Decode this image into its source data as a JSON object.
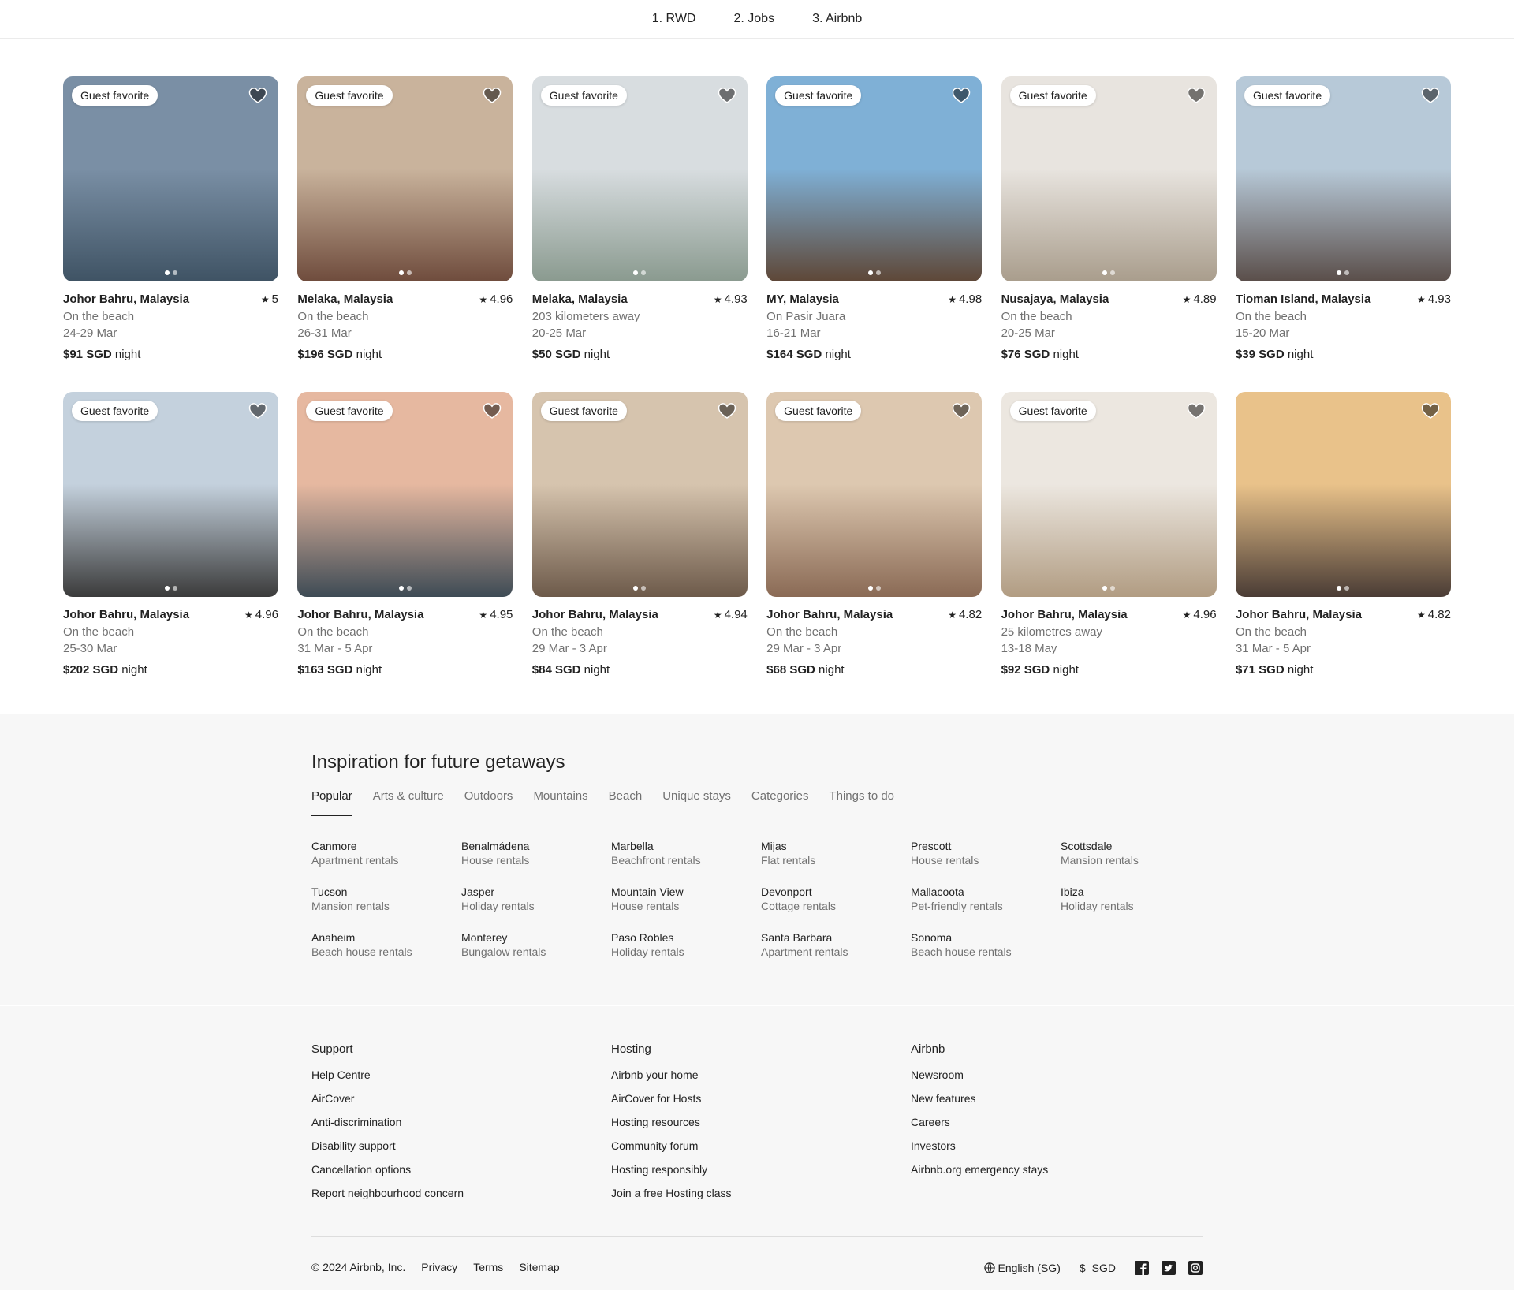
{
  "topnav": [
    "1. RWD",
    "2. Jobs",
    "3. Airbnb"
  ],
  "listings": [
    {
      "badge": "Guest favorite",
      "location": "Johor Bahru, Malaysia",
      "rating": "5",
      "subtitle": "On the beach",
      "dates": "24-29 Mar",
      "price": "$91 SGD",
      "unit": "night",
      "photo": [
        "#7a8fa5",
        "#3f5364"
      ]
    },
    {
      "badge": "Guest favorite",
      "location": "Melaka, Malaysia",
      "rating": "4.96",
      "subtitle": "On the beach",
      "dates": "26-31 Mar",
      "price": "$196 SGD",
      "unit": "night",
      "photo": [
        "#c9b39c",
        "#6f4c3d"
      ]
    },
    {
      "badge": "Guest favorite",
      "location": "Melaka, Malaysia",
      "rating": "4.93",
      "subtitle": "203 kilometers away",
      "dates": "20-25 Mar",
      "price": "$50 SGD",
      "unit": "night",
      "photo": [
        "#d8dde0",
        "#8a9a8f"
      ]
    },
    {
      "badge": "Guest favorite",
      "location": "MY, Malaysia",
      "rating": "4.98",
      "subtitle": "On Pasir Juara",
      "dates": "16-21 Mar",
      "price": "$164 SGD",
      "unit": "night",
      "photo": [
        "#7fb0d6",
        "#5e4737"
      ]
    },
    {
      "badge": "Guest favorite",
      "location": "Nusajaya, Malaysia",
      "rating": "4.89",
      "subtitle": "On the beach",
      "dates": "20-25 Mar",
      "price": "$76 SGD",
      "unit": "night",
      "photo": [
        "#e8e4df",
        "#a99d8c"
      ]
    },
    {
      "badge": "Guest favorite",
      "location": "Tioman Island, Malaysia",
      "rating": "4.93",
      "subtitle": "On the beach",
      "dates": "15-20 Mar",
      "price": "$39 SGD",
      "unit": "night",
      "photo": [
        "#b7c9d8",
        "#5a4e4a"
      ]
    },
    {
      "badge": "Guest favorite",
      "location": "Johor Bahru, Malaysia",
      "rating": "4.96",
      "subtitle": "On the beach",
      "dates": "25-30 Mar",
      "price": "$202 SGD",
      "unit": "night",
      "photo": [
        "#c4d1dd",
        "#3b3b3b"
      ]
    },
    {
      "badge": "Guest favorite",
      "location": "Johor Bahru, Malaysia",
      "rating": "4.95",
      "subtitle": "On the beach",
      "dates": "31 Mar - 5 Apr",
      "price": "$163 SGD",
      "unit": "night",
      "photo": [
        "#e6b8a0",
        "#3e4b55"
      ]
    },
    {
      "badge": "Guest favorite",
      "location": "Johor Bahru, Malaysia",
      "rating": "4.94",
      "subtitle": "On the beach",
      "dates": "29 Mar - 3 Apr",
      "price": "$84 SGD",
      "unit": "night",
      "photo": [
        "#d6c4ae",
        "#6d5a4a"
      ]
    },
    {
      "badge": "Guest favorite",
      "location": "Johor Bahru, Malaysia",
      "rating": "4.82",
      "subtitle": "On the beach",
      "dates": "29 Mar - 3 Apr",
      "price": "$68 SGD",
      "unit": "night",
      "photo": [
        "#ddc8b0",
        "#8a6a55"
      ]
    },
    {
      "badge": "Guest favorite",
      "location": "Johor Bahru, Malaysia",
      "rating": "4.96",
      "subtitle": "25 kilometres away",
      "dates": "13-18 May",
      "price": "$92 SGD",
      "unit": "night",
      "photo": [
        "#ece7e0",
        "#b19c82"
      ]
    },
    {
      "badge": "",
      "location": "Johor Bahru, Malaysia",
      "rating": "4.82",
      "subtitle": "On the beach",
      "dates": "31 Mar - 5 Apr",
      "price": "$71 SGD",
      "unit": "night",
      "photo": [
        "#e9c28a",
        "#4a3c35"
      ]
    }
  ],
  "inspiration": {
    "title": "Inspiration for future getaways",
    "tabs": [
      "Popular",
      "Arts & culture",
      "Outdoors",
      "Mountains",
      "Beach",
      "Unique stays",
      "Categories",
      "Things to do"
    ],
    "destinations": [
      {
        "name": "Canmore",
        "type": "Apartment rentals"
      },
      {
        "name": "Benalmádena",
        "type": "House rentals"
      },
      {
        "name": "Marbella",
        "type": "Beachfront rentals"
      },
      {
        "name": "Mijas",
        "type": "Flat rentals"
      },
      {
        "name": "Prescott",
        "type": "House rentals"
      },
      {
        "name": "Scottsdale",
        "type": "Mansion rentals"
      },
      {
        "name": "Tucson",
        "type": "Mansion rentals"
      },
      {
        "name": "Jasper",
        "type": "Holiday rentals"
      },
      {
        "name": "Mountain View",
        "type": "House rentals"
      },
      {
        "name": "Devonport",
        "type": "Cottage rentals"
      },
      {
        "name": "Mallacoota",
        "type": "Pet-friendly rentals"
      },
      {
        "name": "Ibiza",
        "type": "Holiday rentals"
      },
      {
        "name": "Anaheim",
        "type": "Beach house rentals"
      },
      {
        "name": "Monterey",
        "type": "Bungalow rentals"
      },
      {
        "name": "Paso Robles",
        "type": "Holiday rentals"
      },
      {
        "name": "Santa Barbara",
        "type": "Apartment rentals"
      },
      {
        "name": "Sonoma",
        "type": "Beach house rentals"
      }
    ]
  },
  "footer": {
    "columns": [
      {
        "title": "Support",
        "links": [
          "Help Centre",
          "AirCover",
          "Anti-discrimination",
          "Disability support",
          "Cancellation options",
          "Report neighbourhood concern"
        ]
      },
      {
        "title": "Hosting",
        "links": [
          "Airbnb your home",
          "AirCover for Hosts",
          "Hosting resources",
          "Community forum",
          "Hosting responsibly",
          "Join a free Hosting class"
        ]
      },
      {
        "title": "Airbnb",
        "links": [
          "Newsroom",
          "New features",
          "Careers",
          "Investors",
          "Airbnb.org emergency stays"
        ]
      }
    ],
    "copyright": "© 2024 Airbnb, Inc.",
    "legal": [
      "Privacy",
      "Terms",
      "Sitemap"
    ],
    "language": "English (SG)",
    "currency_symbol": "$",
    "currency": "SGD"
  }
}
